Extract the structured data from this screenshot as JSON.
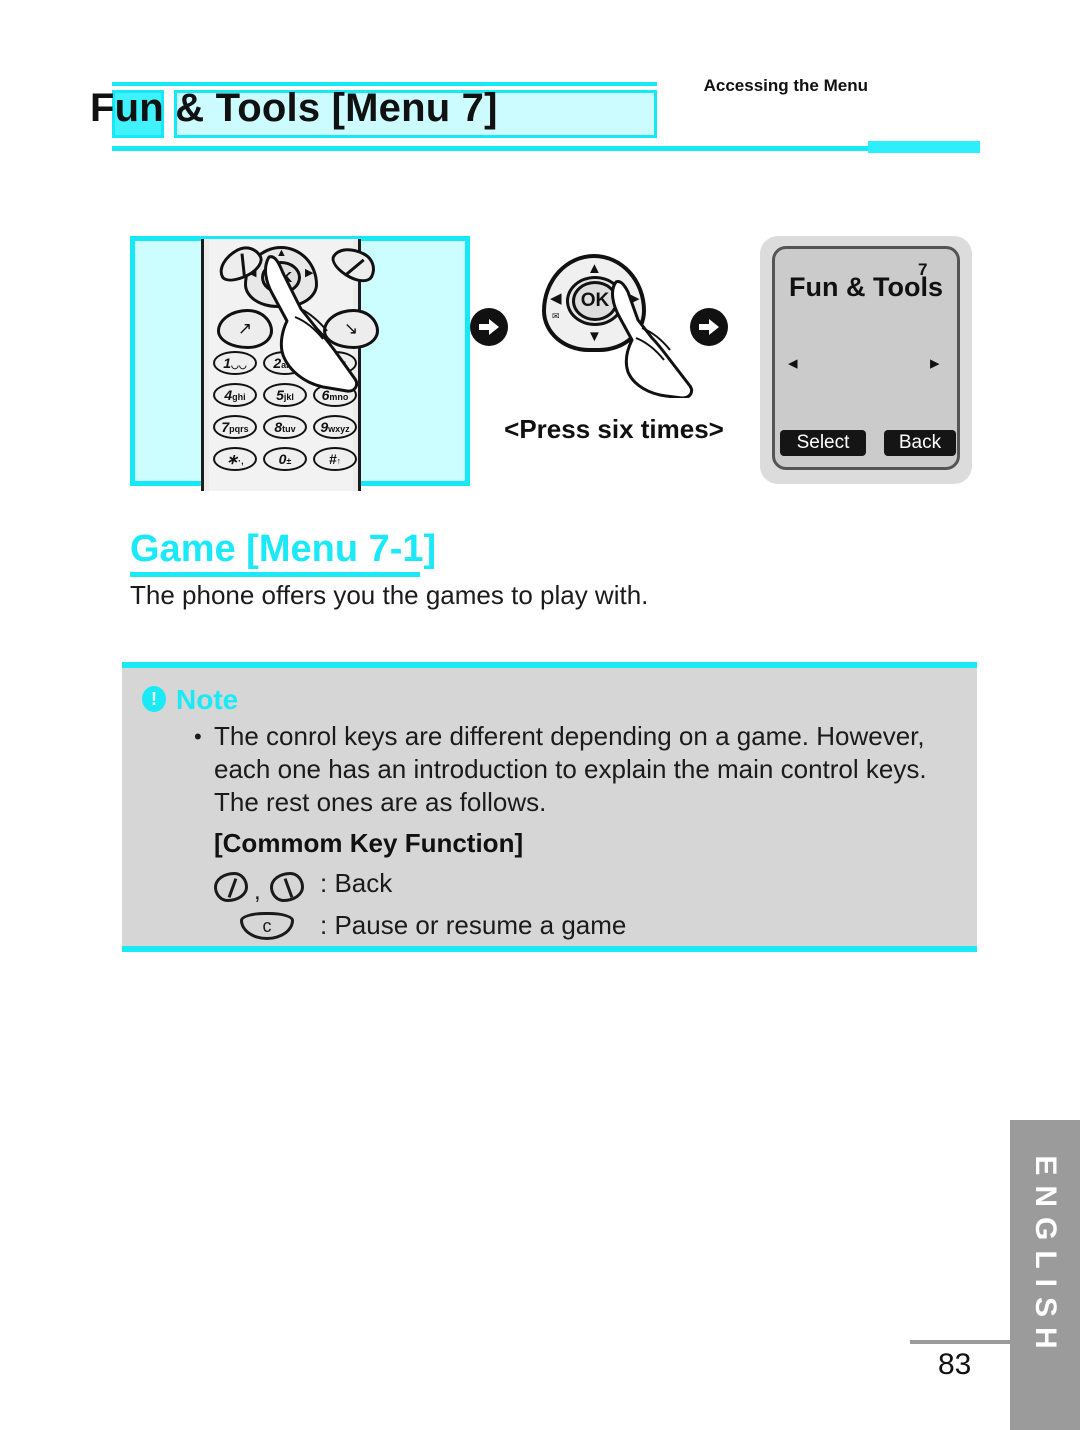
{
  "header": {
    "title": "Fun & Tools [Menu 7]",
    "subtitle": "Accessing the Menu",
    "accent_color": "#15e9f5",
    "title_box_color": "#ccfcff"
  },
  "illustration": {
    "phone_keypad": {
      "nav_ok_label": "OK",
      "nav_up": "▲",
      "nav_down": "▼",
      "nav_left": "◀",
      "nav_right": "▶",
      "send_key": "↗",
      "end_key": "↘",
      "keys": [
        {
          "digit": "1",
          "letters": "◡◡"
        },
        {
          "digit": "2",
          "letters": "abc"
        },
        {
          "digit": "3",
          "letters": "def"
        },
        {
          "digit": "4",
          "letters": "ghi"
        },
        {
          "digit": "5",
          "letters": "jkl"
        },
        {
          "digit": "6",
          "letters": "mno"
        },
        {
          "digit": "7",
          "letters": "pqrs"
        },
        {
          "digit": "8",
          "letters": "tuv"
        },
        {
          "digit": "9",
          "letters": "wxyz"
        },
        {
          "digit": "∗",
          "letters": "·,"
        },
        {
          "digit": "0",
          "letters": "±"
        },
        {
          "digit": "#",
          "letters": "↑"
        }
      ]
    },
    "arrow_1": "right-arrow",
    "arrow_2": "right-arrow",
    "center_nav": {
      "ok_label": "OK",
      "up": "▲",
      "down": "▼",
      "left": "◀",
      "right": "▶",
      "icon_left": "✉",
      "icon_right": "✉"
    },
    "press_label": "<Press six times>",
    "phone_screen": {
      "title": "Fun & Tools",
      "menu_number": "7",
      "left_arrow": "◂",
      "right_arrow": "▸",
      "left_softkey": "Select",
      "right_softkey": "Back"
    }
  },
  "section": {
    "heading": "Game [Menu 7-1]",
    "heading_color": "#1ce9f7",
    "body": "The phone offers you the games to play with."
  },
  "note": {
    "icon": "exclamation-icon",
    "icon_glyph": "!",
    "label": "Note",
    "bullet_glyph": "•",
    "bullet_text": "The conrol keys are different depending on a game. However, each one has an introduction to explain the main control keys. The rest ones are as follows.",
    "common_key_title": "[Commom Key Function]",
    "rows": [
      {
        "icons": "softkey-left, softkey-right",
        "text": ": Back"
      },
      {
        "icons": "clear-key",
        "key_label": "c",
        "text": ": Pause or resume  a game"
      }
    ],
    "row1_text": ": Back",
    "row2_text": ": Pause or resume  a game",
    "row2_key_label": "c",
    "comma": ",",
    "background_color": "#d6d6d6",
    "border_color": "#19eaf6"
  },
  "footer": {
    "language_tab": "ENGLISH",
    "page_number": "83",
    "tab_color": "#9b9b9b"
  }
}
